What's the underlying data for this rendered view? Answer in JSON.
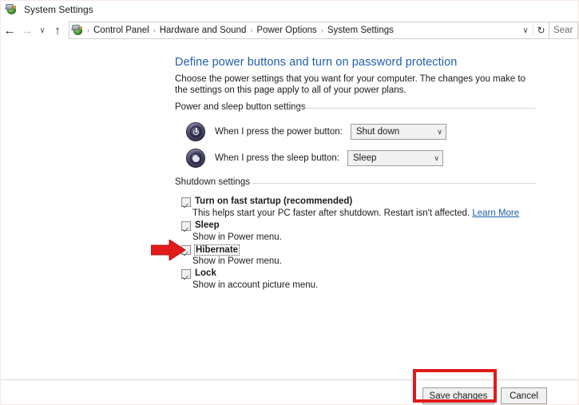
{
  "window": {
    "title": "System Settings",
    "icon": "control-panel-icon"
  },
  "nav": {
    "back": "←",
    "forward": "→",
    "recent": "∨",
    "up": "↑",
    "breadcrumbs": [
      "Control Panel",
      "Hardware and Sound",
      "Power Options",
      "System Settings"
    ],
    "separator": "›",
    "dropdown": "∨",
    "refresh": "↻",
    "search_placeholder": "Sear"
  },
  "page": {
    "heading": "Define power buttons and turn on password protection",
    "description": "Choose the power settings that you want for your computer. The changes you make to the settings on this page apply to all of your power plans."
  },
  "power_sleep_section": {
    "label": "Power and sleep button settings",
    "rows": [
      {
        "icon": "power-button-icon",
        "label": "When I press the power button:",
        "value": "Shut down",
        "chevron": "∨"
      },
      {
        "icon": "sleep-button-icon",
        "label": "When I press the sleep button:",
        "value": "Sleep",
        "chevron": "∨"
      }
    ]
  },
  "shutdown_section": {
    "label": "Shutdown settings",
    "items": [
      {
        "label": "Turn on fast startup (recommended)",
        "checked": true,
        "sub": "This helps start your PC faster after shutdown. Restart isn't affected.",
        "link": "Learn More",
        "focused": false
      },
      {
        "label": "Sleep",
        "checked": true,
        "sub": "Show in Power menu.",
        "link": "",
        "focused": false
      },
      {
        "label": "Hibernate",
        "checked": true,
        "sub": "Show in Power menu.",
        "link": "",
        "focused": true
      },
      {
        "label": "Lock",
        "checked": true,
        "sub": "Show in account picture menu.",
        "link": "",
        "focused": false
      }
    ]
  },
  "footer": {
    "save_label": "Save changes",
    "cancel_label": "Cancel"
  },
  "annotations": {
    "arrow_color": "#e01b1b",
    "box_color": "#e01b1b",
    "arrow_target": "Hibernate",
    "box_target": "Save changes"
  },
  "colors": {
    "link": "#1f5fa9",
    "heading": "#1f5fa9",
    "text": "#1b1b1b",
    "annotation": "#e01b1b"
  }
}
